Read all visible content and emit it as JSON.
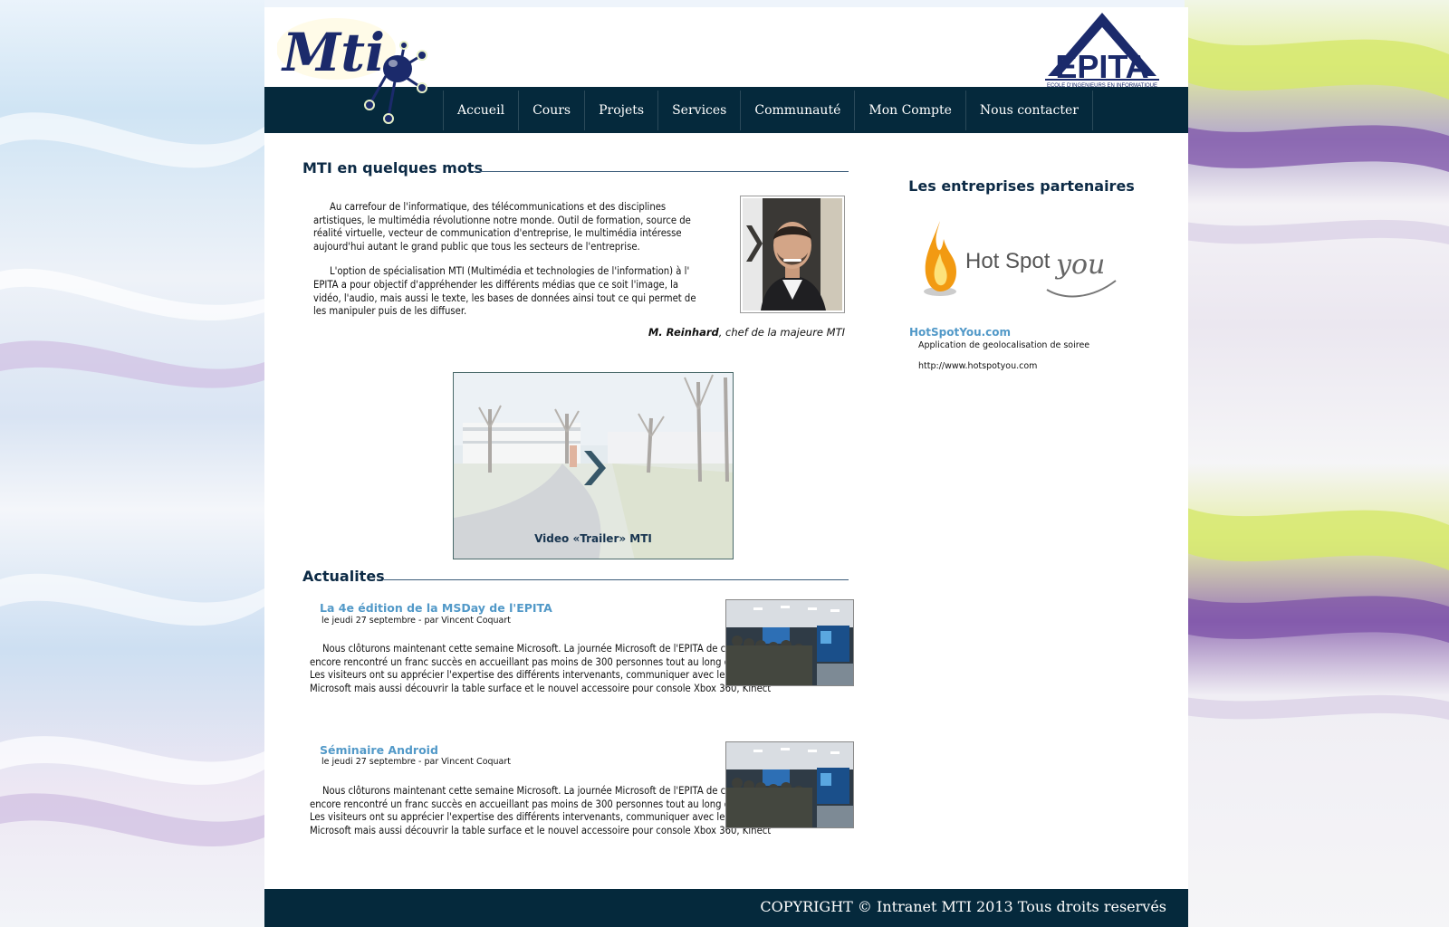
{
  "colors": {
    "navy": "#05293c",
    "accent_blue": "#5299c8",
    "title": "#0c2a45"
  },
  "header": {
    "logo_text": "Mti",
    "epita_logo_text": "EPITA",
    "epita_tagline": "ECOLE D'INGENIEURS EN INFORMATIQUE"
  },
  "nav": [
    "Accueil",
    "Cours",
    "Projets",
    "Services",
    "Communauté",
    "Mon Compte",
    "Nous contacter"
  ],
  "intro": {
    "title": "MTI en quelques mots",
    "paragraphs": [
      "Au carrefour de l'informatique, des télécommunications et des disciplines artistiques, le multimédia révolutionne notre monde. Outil de formation, source de réalité virtuelle, vecteur de communication d'entreprise, le multimédia intéresse aujourd'hui autant le grand public que tous les secteurs de l'entreprise.",
      "L'option de spécialisation MTI (Multimédia et technologies de l'information) à l' EPITA a pour objectif d'appréhender les différents médias que ce soit l'image, la vidéo, l'audio, mais aussi le texte, les bases de données ainsi tout ce qui permet de les manipuler puis de les diffuser."
    ],
    "signature_name": "M. Reinhard",
    "signature_role": ", chef de la majeure MTI"
  },
  "video": {
    "label": "Video «Trailer» MTI",
    "icon": "play-chevron-icon"
  },
  "news": {
    "title": "Actualites",
    "items": [
      {
        "title": "La 4e édition de la MSDay de l'EPITA",
        "meta": "le jeudi 27 septembre - par Vincent Coquart",
        "body": "Nous clôturons maintenant cette semaine Microsoft. La journée Microsoft de l'EPITA de cette année a encore rencontré un franc succès en accueillant pas moins de 300 personnes tout au long de la journée. Les visiteurs ont su apprécier l'expertise des différents intervenants, communiquer avec les responsables Microsoft mais aussi découvrir la table surface et le nouvel accessoire pour console Xbox 360, Kinect"
      },
      {
        "title": "Séminaire Android",
        "meta": "le jeudi 27 septembre - par Vincent Coquart",
        "body": "Nous clôturons maintenant cette semaine Microsoft. La journée Microsoft de l'EPITA de cette année a encore rencontré un franc succès en accueillant pas moins de 300 personnes tout au long de la journée. Les visiteurs ont su apprécier l'expertise des différents intervenants, communiquer avec les responsables Microsoft mais aussi découvrir la table surface et le nouvel accessoire pour console Xbox 360, Kinect"
      }
    ]
  },
  "partners": {
    "title": "Les entreprises partenaires",
    "logo_text_1": "Hot Spot",
    "logo_text_2": "you",
    "name": "HotSpotYou.com",
    "description": "Application de geolocalisation de soiree",
    "url": "http://www.hotspotyou.com"
  },
  "footer": {
    "copyright": "COPYRIGHT © Intranet MTI 2013 Tous droits reservés"
  }
}
